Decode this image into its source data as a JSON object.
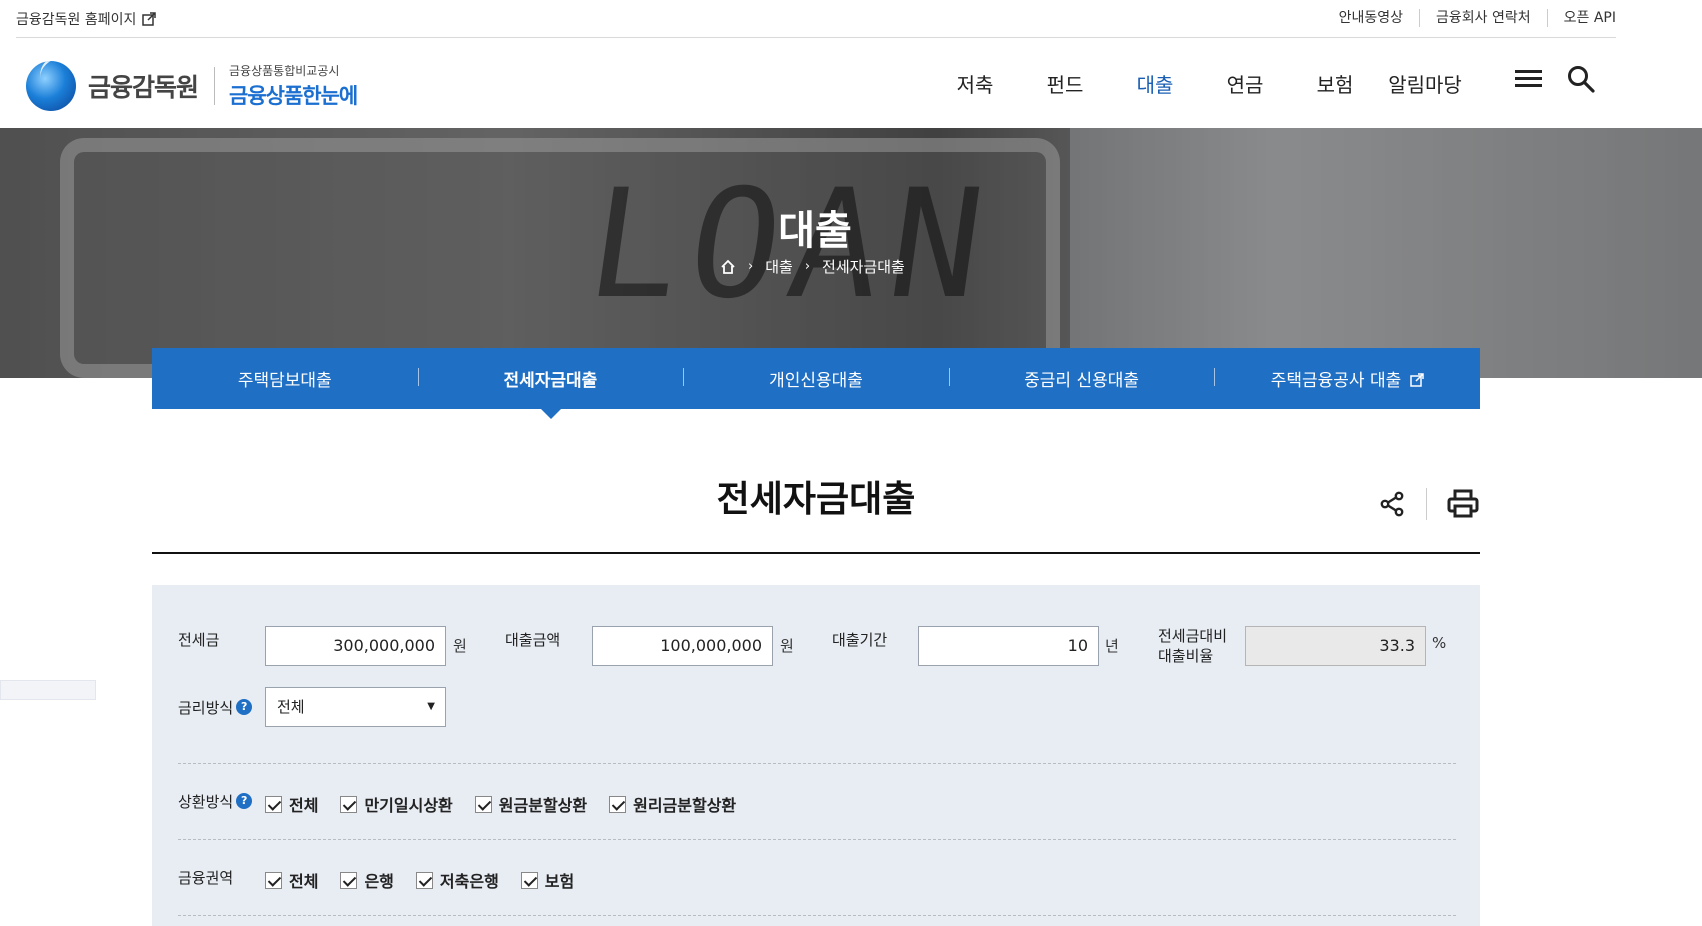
{
  "util": {
    "fss_home": "금융감독원 홈페이지",
    "links": [
      "안내동영상",
      "금융회사 연락처",
      "오픈 API"
    ]
  },
  "logo": {
    "fss": "금융감독원",
    "sub_small": "금융상품통합비교공시",
    "sub_big": "금융상품한눈에"
  },
  "gnb": [
    "저축",
    "펀드",
    "대출",
    "연금",
    "보험",
    "알림마당"
  ],
  "hero": {
    "title": "대출",
    "breadcrumb": [
      "대출",
      "전세자금대출"
    ]
  },
  "tabs": [
    "주택담보대출",
    "전세자금대출",
    "개인신용대출",
    "중금리 신용대출",
    "주택금융공사 대출"
  ],
  "page_title": "전세자금대출",
  "form": {
    "deposit_label": "전세금",
    "deposit_value": "300,000,000",
    "loan_label": "대출금액",
    "loan_value": "100,000,000",
    "period_label": "대출기간",
    "period_value": "10",
    "ratio_label_1": "전세금대비",
    "ratio_label_2": "대출비율",
    "ratio_value": "33.3",
    "unit_won": "원",
    "unit_year": "년",
    "unit_pct": "%",
    "rate_label": "금리방식",
    "rate_selected": "전체",
    "repay_label": "상환방식",
    "repay_options": [
      "전체",
      "만기일시상환",
      "원금분할상환",
      "원리금분할상환"
    ],
    "sector_label": "금융권역",
    "sector_options": [
      "전체",
      "은행",
      "저축은행",
      "보험"
    ]
  },
  "colors": {
    "brand_blue": "#1f6fc5",
    "panel_bg": "#e8edf4"
  },
  "icons": [
    "external-link-icon",
    "menu-icon",
    "search-icon",
    "home-icon",
    "share-icon",
    "print-icon",
    "help-icon",
    "checkbox-icon"
  ]
}
